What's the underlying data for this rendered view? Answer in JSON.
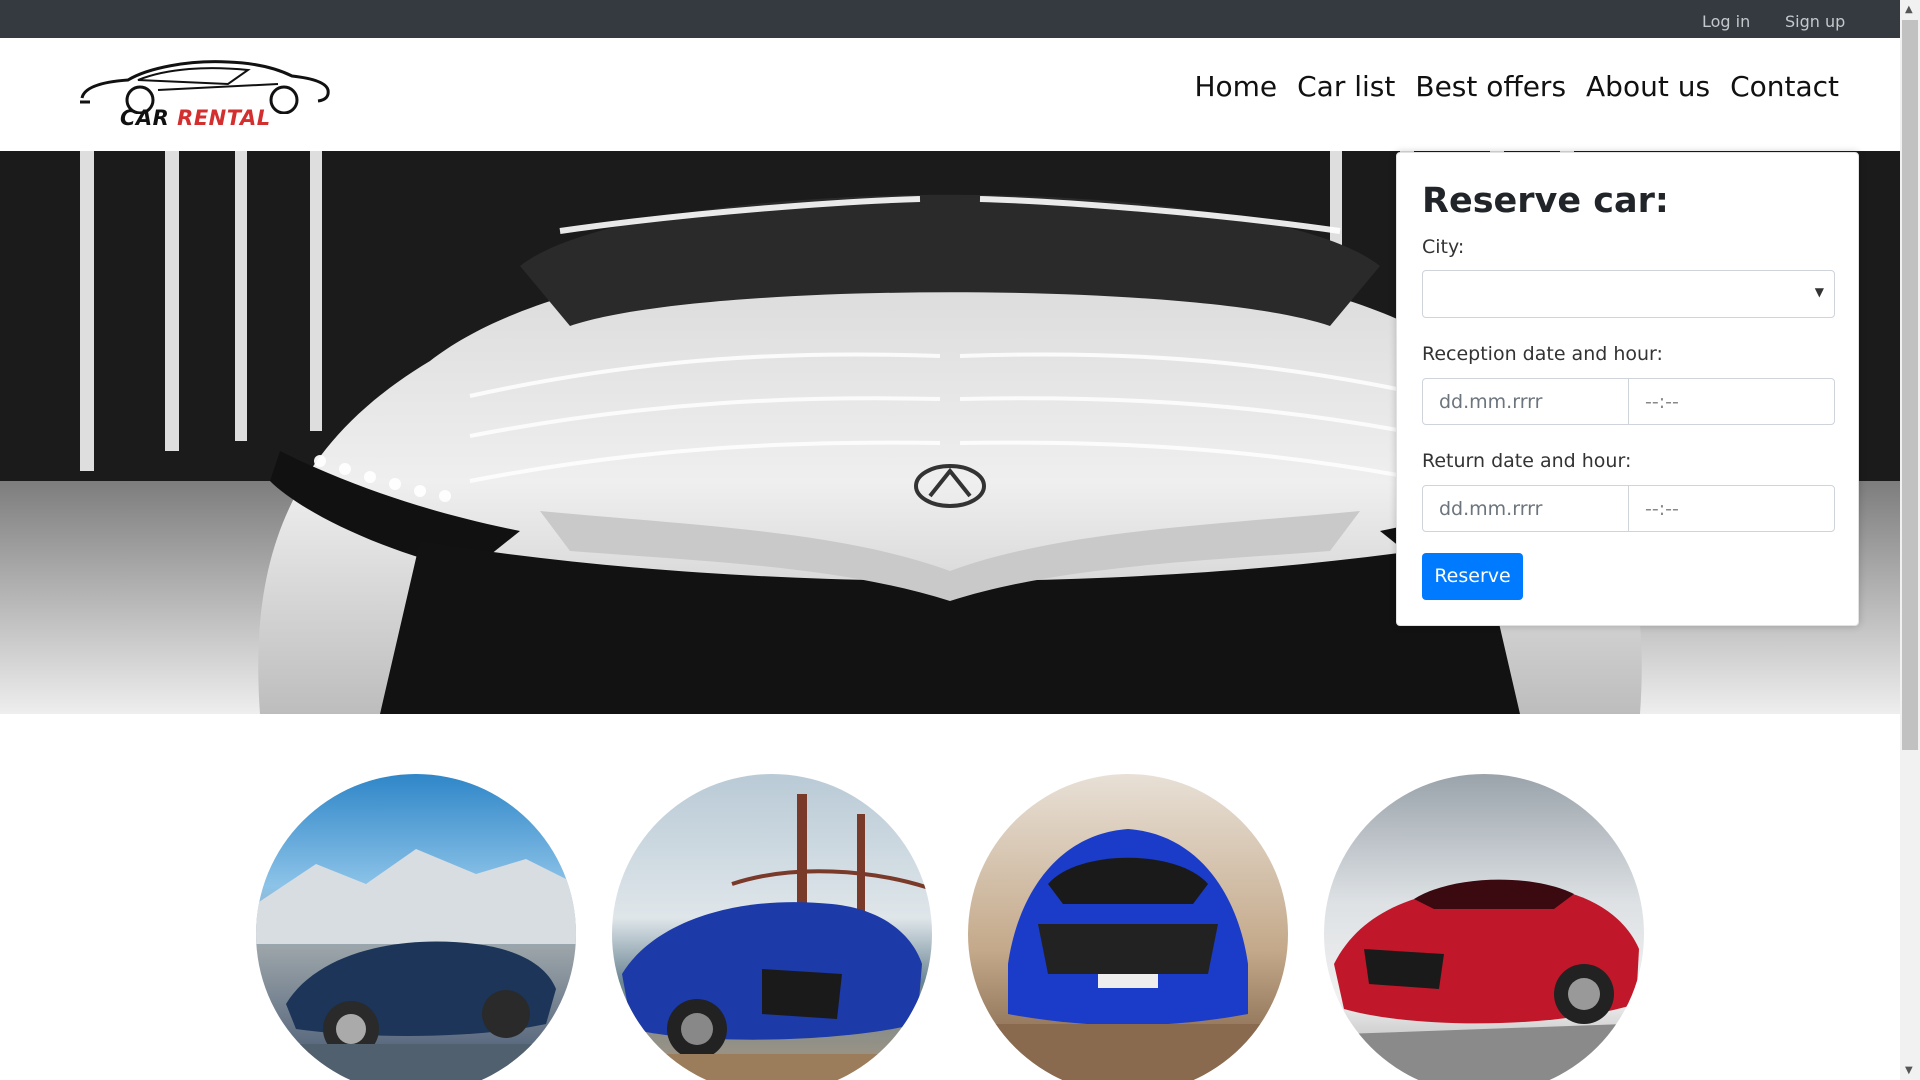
{
  "topbar": {
    "login": "Log in",
    "signup": "Sign up"
  },
  "logo": {
    "word1": "CAR",
    "word2": "RENTAL"
  },
  "nav": [
    {
      "label": "Home"
    },
    {
      "label": "Car list"
    },
    {
      "label": "Best offers"
    },
    {
      "label": "About us"
    },
    {
      "label": "Contact"
    }
  ],
  "reserve": {
    "title": "Reserve car:",
    "city_label": "City:",
    "city_value": "",
    "reception_label": "Reception date and hour:",
    "reception_date": "dd.mm.rrrr",
    "reception_time": "--:--",
    "return_label": "Return date and hour:",
    "return_date": "dd.mm.rrrr",
    "return_time": "--:--",
    "button": "Reserve"
  },
  "colors": {
    "accent": "#007bff",
    "topbar": "#343a40",
    "logo_red": "#d32f2f"
  },
  "icons": {
    "select_arrow": "chevron-down-icon"
  }
}
